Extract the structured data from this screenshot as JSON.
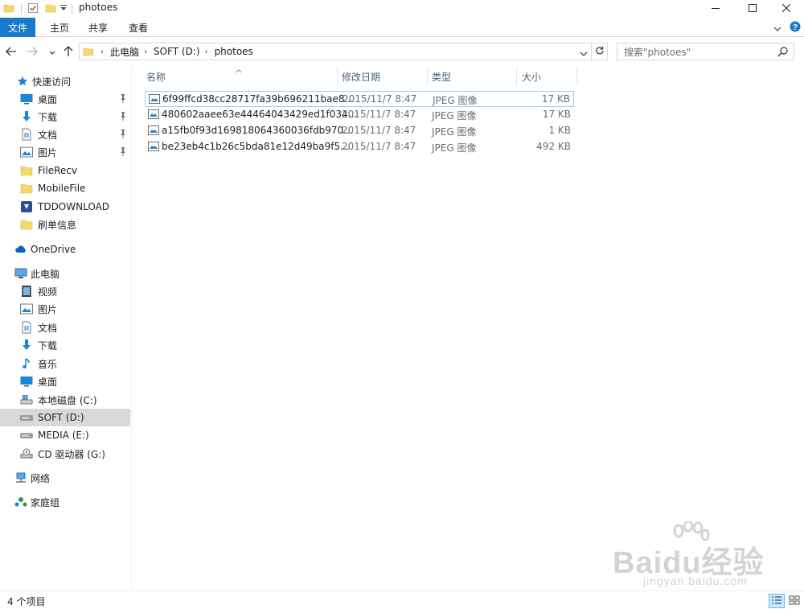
{
  "window": {
    "title": "photoes",
    "minimize_icon": "minimize-icon",
    "maximize_icon": "maximize-icon",
    "close_icon": "close-icon"
  },
  "ribbon": {
    "tabs": [
      "文件",
      "主页",
      "共享",
      "查看"
    ],
    "accent": "#1979ca"
  },
  "address": {
    "crumbs": [
      "此电脑",
      "SOFT (D:)",
      "photoes"
    ],
    "search_placeholder": "搜索\"photoes\""
  },
  "nav": {
    "quick_access": "快速访问",
    "quick_items": [
      {
        "label": "桌面",
        "icon": "desktop-icon",
        "pinned": true
      },
      {
        "label": "下载",
        "icon": "download-icon",
        "pinned": true
      },
      {
        "label": "文档",
        "icon": "document-icon",
        "pinned": true
      },
      {
        "label": "图片",
        "icon": "pictures-icon",
        "pinned": true
      },
      {
        "label": "FileRecv",
        "icon": "folder-icon",
        "pinned": false
      },
      {
        "label": "MobileFile",
        "icon": "folder-icon",
        "pinned": false
      },
      {
        "label": "TDDOWNLOAD",
        "icon": "tddownload-folder-icon",
        "pinned": false
      },
      {
        "label": "刷单信息",
        "icon": "folder-icon",
        "pinned": false
      }
    ],
    "onedrive": "OneDrive",
    "this_pc": "此电脑",
    "pc_items": [
      {
        "label": "视频",
        "icon": "video-icon"
      },
      {
        "label": "图片",
        "icon": "pictures-icon"
      },
      {
        "label": "文档",
        "icon": "document-icon"
      },
      {
        "label": "下载",
        "icon": "download-icon"
      },
      {
        "label": "音乐",
        "icon": "music-icon"
      },
      {
        "label": "桌面",
        "icon": "desktop-icon"
      },
      {
        "label": "本地磁盘 (C:)",
        "icon": "windows-drive-icon"
      },
      {
        "label": "SOFT (D:)",
        "icon": "drive-icon",
        "selected": true
      },
      {
        "label": "MEDIA (E:)",
        "icon": "drive-icon"
      },
      {
        "label": "CD 驱动器 (G:)",
        "icon": "cd-drive-icon"
      }
    ],
    "network": "网络",
    "homegroup": "家庭组"
  },
  "columns": {
    "name": "名称",
    "date": "修改日期",
    "type": "类型",
    "size": "大小"
  },
  "files": [
    {
      "name": "6f99ffcd38cc28717fa39b696211bae8...",
      "date": "2015/11/7 8:47",
      "type": "JPEG 图像",
      "size": "17 KB"
    },
    {
      "name": "480602aaee63e44464043429ed1f034...",
      "date": "2015/11/7 8:47",
      "type": "JPEG 图像",
      "size": "17 KB"
    },
    {
      "name": "a15fb0f93d169818064360036fdb970...",
      "date": "2015/11/7 8:47",
      "type": "JPEG 图像",
      "size": "1 KB"
    },
    {
      "name": "be23eb4c1b26c5bda81e12d49ba9f5...",
      "date": "2015/11/7 8:47",
      "type": "JPEG 图像",
      "size": "492 KB"
    }
  ],
  "status": {
    "item_count": "4 个项目"
  },
  "watermark": {
    "brand": "Baidu经验",
    "url": "jingyan.baidu.com"
  }
}
